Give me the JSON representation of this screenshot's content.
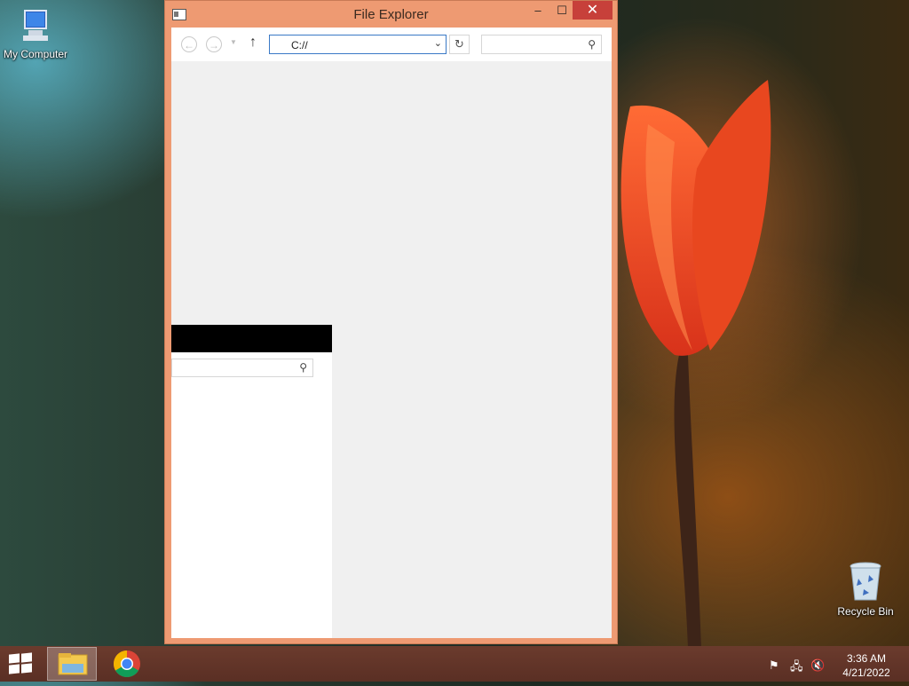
{
  "desktop": {
    "icons": [
      {
        "label": "My Computer",
        "icon": "computer-icon"
      },
      {
        "label": "Recycle Bin",
        "icon": "recycle-bin-icon"
      }
    ]
  },
  "window": {
    "title": "File Explorer",
    "controls": {
      "minimize": "–",
      "maximize": "☐",
      "close": "✕"
    },
    "nav": {
      "back": "←",
      "forward": "→",
      "recent": "▼",
      "up": "↑",
      "address": "C://",
      "refresh": "↻",
      "search_placeholder": ""
    },
    "left_pane": {
      "search_placeholder": ""
    }
  },
  "taskbar": {
    "pinned": [
      "file-explorer-icon",
      "chrome-icon"
    ],
    "tray": {
      "time": "3:36 AM",
      "date": "4/21/2022"
    }
  },
  "colors": {
    "window_frame": "#ee9a72",
    "close_button": "#c7403a",
    "taskbar": "#6b3b2d",
    "address_border": "#3a79c6"
  }
}
